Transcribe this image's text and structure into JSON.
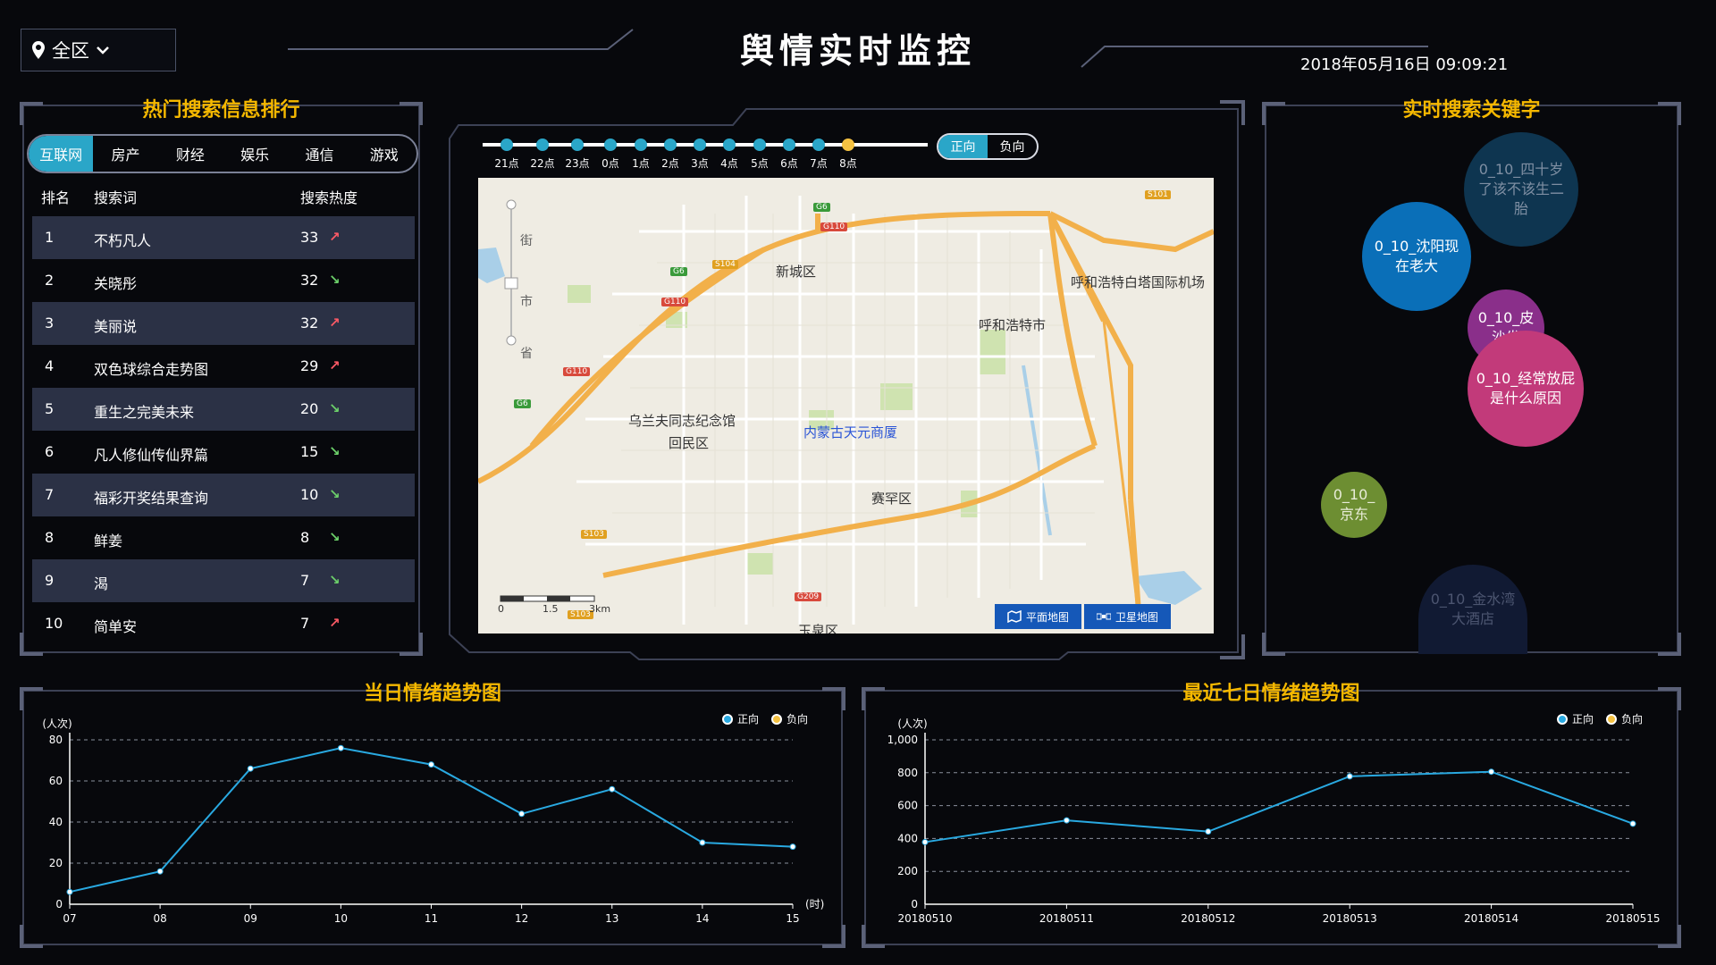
{
  "header": {
    "region": "全区",
    "title": "舆情实时监控",
    "datetime": "2018年05月16日 09:09:21"
  },
  "ranking": {
    "title": "热门搜索信息排行",
    "tabs": [
      "互联网",
      "房产",
      "财经",
      "娱乐",
      "通信",
      "游戏"
    ],
    "active_tab": 0,
    "columns": [
      "排名",
      "搜索词",
      "搜索热度"
    ],
    "rows": [
      {
        "rank": "1",
        "term": "不朽凡人",
        "heat": "33",
        "trend": "up"
      },
      {
        "rank": "2",
        "term": "关晓彤",
        "heat": "32",
        "trend": "down"
      },
      {
        "rank": "3",
        "term": "美丽说",
        "heat": "32",
        "trend": "up"
      },
      {
        "rank": "4",
        "term": "双色球综合走势图",
        "heat": "29",
        "trend": "up"
      },
      {
        "rank": "5",
        "term": "重生之完美未来",
        "heat": "20",
        "trend": "down"
      },
      {
        "rank": "6",
        "term": "凡人修仙传仙界篇",
        "heat": "15",
        "trend": "down"
      },
      {
        "rank": "7",
        "term": "福彩开奖结果查询",
        "heat": "10",
        "trend": "down"
      },
      {
        "rank": "8",
        "term": "鲜姜",
        "heat": "8",
        "trend": "down"
      },
      {
        "rank": "9",
        "term": "渴",
        "heat": "7",
        "trend": "down"
      },
      {
        "rank": "10",
        "term": "简单安",
        "heat": "7",
        "trend": "up"
      }
    ],
    "trend_colors": {
      "up": "#ff5a66",
      "down": "#6cd06a"
    }
  },
  "timeline": {
    "hours": [
      "21点",
      "22点",
      "23点",
      "0点",
      "1点",
      "2点",
      "3点",
      "4点",
      "5点",
      "6点",
      "7点",
      "8点"
    ],
    "current_index": 11,
    "polarity": [
      "正向",
      "负向"
    ],
    "active_polarity": 0
  },
  "map": {
    "labels": {
      "xinchengqu": "新城区",
      "huhehaote": "呼和浩特市",
      "airport": "呼和浩特白塔国际机场",
      "huiminqu": "回民区",
      "saihanqu": "赛罕区",
      "yuquanqu": "玉泉区",
      "memorial": "乌兰夫同志纪念馆",
      "tianyuan": "内蒙古天元商厦",
      "zoom_street": "街",
      "zoom_city": "市",
      "zoom_province": "省"
    },
    "badges": [
      "G6",
      "G110",
      "S104",
      "G6",
      "G110",
      "G110",
      "G6",
      "S101",
      "S103",
      "G209",
      "S103"
    ],
    "scale": {
      "ticks": [
        "0",
        "1.5",
        "3km"
      ]
    },
    "modes": [
      "平面地图",
      "卫星地图"
    ],
    "colors": {
      "land": "#efece3",
      "road_major": "#f2b04a",
      "road": "#ffffff",
      "green": "#cfe3b0",
      "water": "#a9cfe8"
    }
  },
  "keywords": {
    "title": "实时搜索关键字",
    "bubbles": [
      {
        "text": "0_10_四十岁了该不该生二胎",
        "color": "#0e3550",
        "text_color": "#7f8fa3"
      },
      {
        "text": "0_10_沈阳现在老大",
        "color": "#0a6fb8",
        "text_color": "#ffffff"
      },
      {
        "text": "0_10_皮沙发",
        "color": "#8a2f8a",
        "text_color": "#ffffff"
      },
      {
        "text": "0_10_经常放屁是什么原因",
        "color": "#c23a7a",
        "text_color": "#ffffff"
      },
      {
        "text": "0_10_京东",
        "color": "#6d8e32",
        "text_color": "#e8ecd8"
      },
      {
        "text": "0_10_金水湾大酒店",
        "color": "#111a33",
        "text_color": "#4c5570"
      }
    ]
  },
  "charts": {
    "today": {
      "title": "当日情绪趋势图",
      "legend": [
        "正向",
        "负向"
      ],
      "legend_colors": [
        "#29a9e1",
        "#f5c242"
      ]
    },
    "week": {
      "title": "最近七日情绪趋势图",
      "legend": [
        "正向",
        "负向"
      ],
      "legend_colors": [
        "#29a9e1",
        "#f5c242"
      ]
    }
  },
  "chart_data": [
    {
      "type": "line",
      "title": "当日情绪趋势图",
      "ylabel": "(人次)",
      "xlabel": "(时)",
      "categories": [
        "07",
        "08",
        "09",
        "10",
        "11",
        "12",
        "13",
        "14",
        "15"
      ],
      "yticks": [
        "0",
        "20",
        "40",
        "60",
        "80"
      ],
      "ylim": [
        0,
        80
      ],
      "series": [
        {
          "name": "正向",
          "values": [
            6,
            16,
            66,
            76,
            68,
            44,
            56,
            30,
            28
          ]
        }
      ],
      "grid": true,
      "legend_position": "top-right"
    },
    {
      "type": "line",
      "title": "最近七日情绪趋势图",
      "ylabel": "(人次)",
      "categories": [
        "20180510",
        "20180511",
        "20180512",
        "20180513",
        "20180514",
        "20180515"
      ],
      "yticks": [
        "0",
        "200",
        "400",
        "600",
        "800",
        "1,000"
      ],
      "ylim": [
        0,
        1000
      ],
      "series": [
        {
          "name": "正向",
          "values": [
            378,
            510,
            442,
            778,
            806,
            490
          ]
        }
      ],
      "grid": true,
      "legend_position": "top-right"
    }
  ]
}
